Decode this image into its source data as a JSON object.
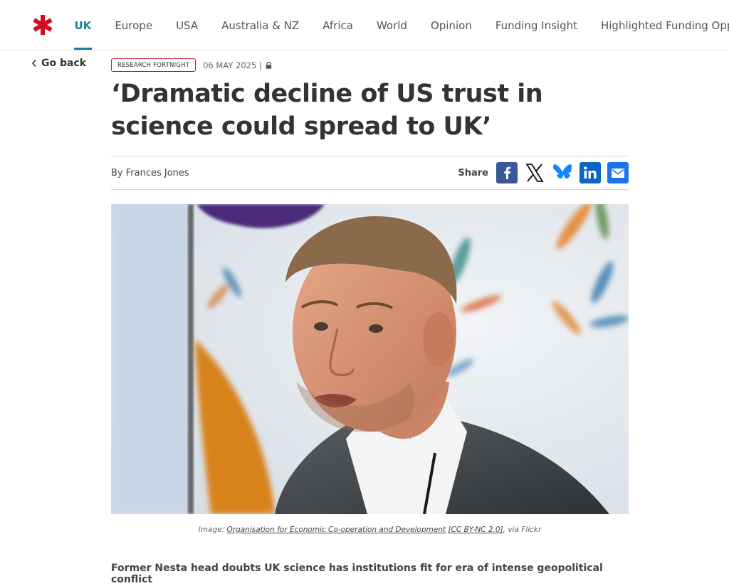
{
  "colors": {
    "accent": "#1e7a9c",
    "brand": "#d40b22",
    "facebook": "#3b5998",
    "bluesky": "#1185fe",
    "linkedin": "#0a66c2",
    "email": "#1a73e8"
  },
  "nav": {
    "logo_icon": "asterisk-logo",
    "items": [
      "UK",
      "Europe",
      "USA",
      "Australia & NZ",
      "Africa",
      "World",
      "Opinion",
      "Funding Insight",
      "Highlighted Funding Opportunities"
    ],
    "active_index": 0
  },
  "back": {
    "label": "Go back",
    "icon": "chevron-left-icon"
  },
  "article": {
    "publication": "RESEARCH FORTNIGHT",
    "date": "06 MAY 2025 |",
    "lock_icon": "lock-icon",
    "headline": "‘Dramatic decline of US trust in science could spread to UK’",
    "byline": "By Frances Jones",
    "share_label": "Share",
    "share_icons": [
      "facebook-icon",
      "x-icon",
      "bluesky-icon",
      "linkedin-icon",
      "email-icon"
    ],
    "caption": {
      "prefix": "Image: ",
      "source": "Organisation for Economic Co-operation and Development",
      "license": "[CC BY-NC 2.0]",
      "suffix": ", via Flickr"
    },
    "standfirst": "Former Nesta head doubts UK science has institutions fit for era of intense geopolitical conflict"
  }
}
